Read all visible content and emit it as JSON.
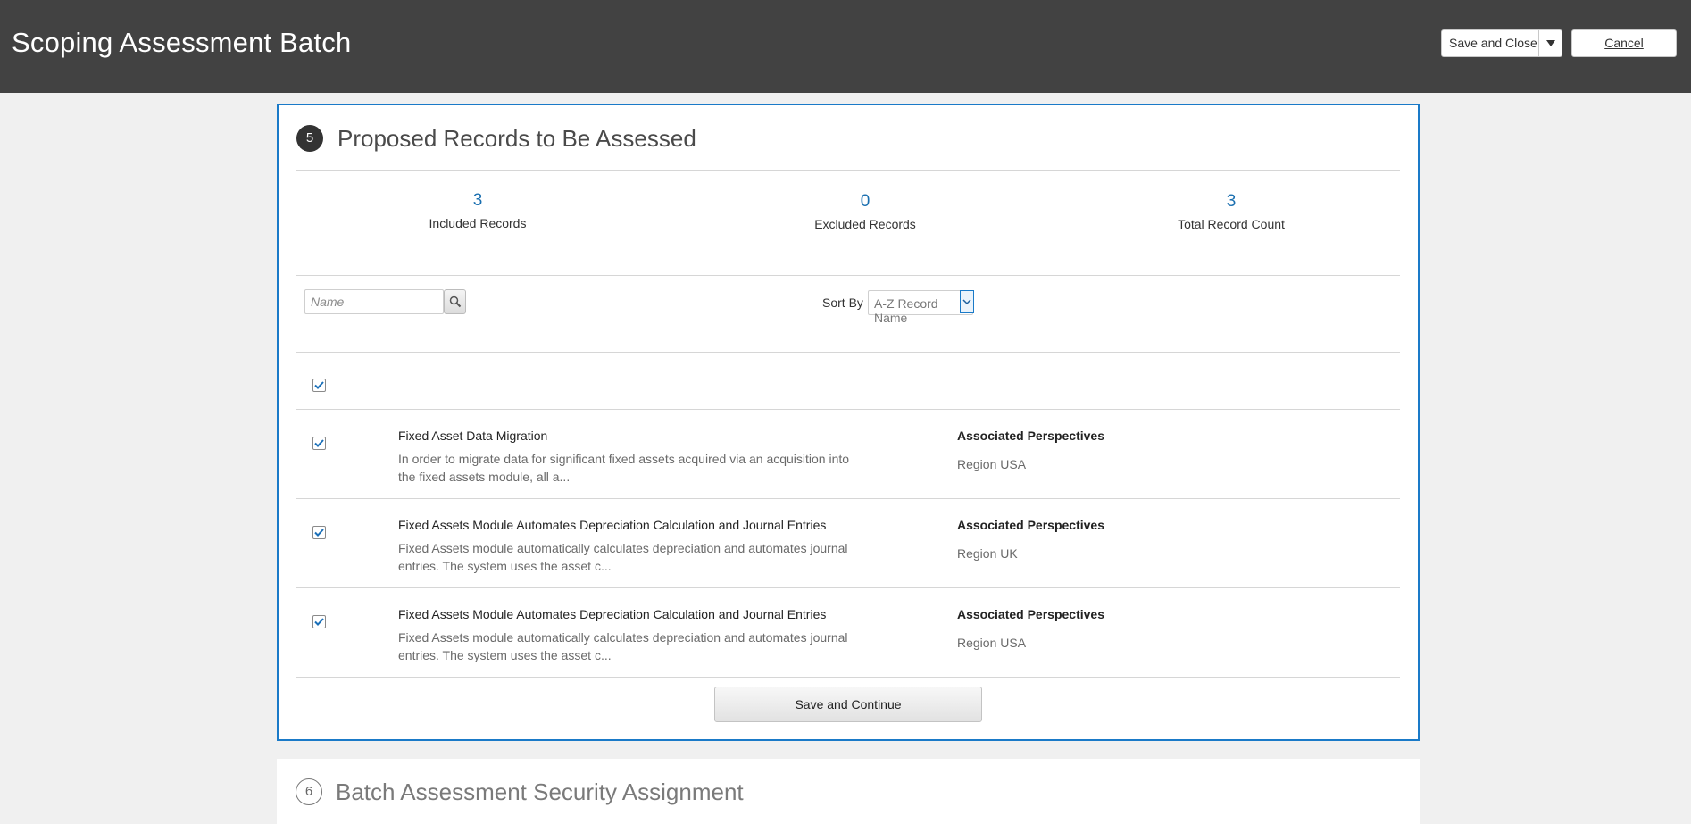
{
  "header": {
    "title": "Scoping Assessment Batch",
    "save_close_label": "Save and Close",
    "cancel_label": "Cancel"
  },
  "step5": {
    "number": "5",
    "title": "Proposed Records to Be Assessed",
    "stats": [
      {
        "value": "3",
        "label": "Included Records"
      },
      {
        "value": "0",
        "label": "Excluded Records"
      },
      {
        "value": "3",
        "label": "Total Record Count"
      }
    ],
    "search": {
      "placeholder": "Name"
    },
    "sort": {
      "label": "Sort By",
      "value": "A-Z Record Name"
    },
    "records": [
      {
        "title": "Fixed Asset Data Migration",
        "desc_line1": "In order to migrate data for significant fixed assets acquired via an acquisition into",
        "desc_line2": "the fixed assets module, all a...",
        "assoc_label": "Associated Perspectives",
        "assoc_value": "Region USA"
      },
      {
        "title": "Fixed Assets Module Automates Depreciation Calculation and Journal Entries",
        "desc_line1": "Fixed Assets module automatically calculates depreciation and automates journal",
        "desc_line2": "entries. The system uses the asset c...",
        "assoc_label": "Associated Perspectives",
        "assoc_value": "Region UK"
      },
      {
        "title": "Fixed Assets Module Automates Depreciation Calculation and Journal Entries",
        "desc_line1": "Fixed Assets module automatically calculates depreciation and automates journal",
        "desc_line2": "entries. The system uses the asset c...",
        "assoc_label": "Associated Perspectives",
        "assoc_value": "Region USA"
      }
    ],
    "save_continue_label": "Save and Continue"
  },
  "step6": {
    "number": "6",
    "title": "Batch Assessment Security Assignment"
  },
  "colors": {
    "header_bg": "#424242",
    "accent": "#1a7ac8",
    "stat_number": "#1a6fb0"
  }
}
